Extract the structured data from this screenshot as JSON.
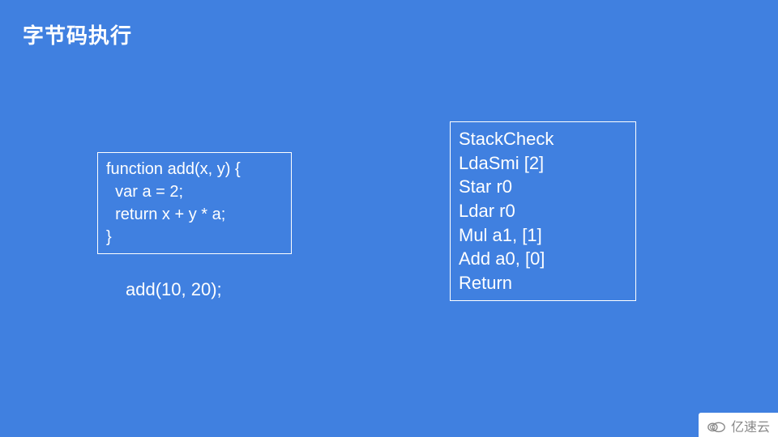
{
  "title": "字节码执行",
  "source": {
    "lines": [
      "function add(x, y) {",
      "  var a = 2;",
      "  return x + y * a;",
      "}"
    ],
    "call": "add(10, 20);"
  },
  "bytecode": {
    "lines": [
      "StackCheck",
      "LdaSmi [2]",
      "Star r0",
      "Ldar r0",
      "Mul a1, [1]",
      "Add a0, [0]",
      "Return"
    ]
  },
  "watermark": {
    "text": "亿速云",
    "icon": "cloud-sync-icon"
  }
}
